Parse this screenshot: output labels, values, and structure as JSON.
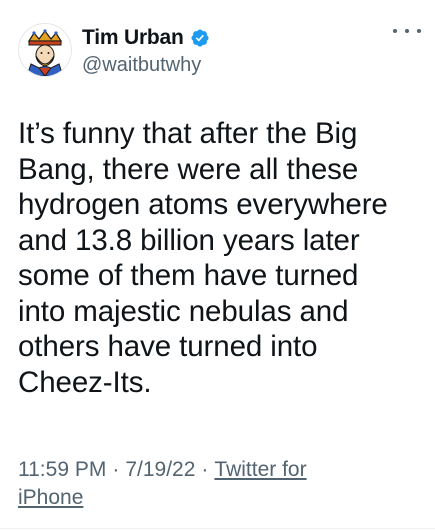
{
  "author": {
    "display_name": "Tim Urban",
    "handle": "@waitbutwhy",
    "avatar_icon": "king-card-avatar",
    "verified": true,
    "verified_color": "#1d9bf0"
  },
  "tweet": {
    "text": "It’s funny that after the Big\nBang, there were all these\nhydrogen atoms everywhere\nand 13.8 billion years later\nsome of them have turned\ninto majestic nebulas and\nothers have turned into\nCheez-Its.",
    "time": "11:59 PM",
    "separator": "·",
    "date": "7/19/22",
    "source_line1": "Twitter for",
    "source_line2": "iPhone"
  },
  "colors": {
    "text_primary": "#0f1419",
    "text_secondary": "#536471"
  },
  "icons": {
    "more": "more-horizontal-icon",
    "verified": "verified-badge-icon"
  }
}
